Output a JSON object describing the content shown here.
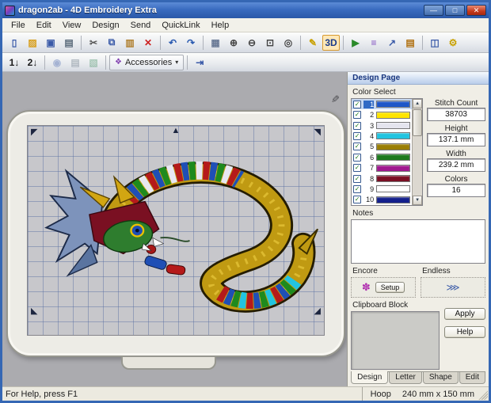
{
  "window": {
    "title": "dragon2ab - 4D Embroidery Extra",
    "controls": [
      {
        "name": "minimize-button",
        "glyph": "—"
      },
      {
        "name": "maximize-button",
        "glyph": "□"
      },
      {
        "name": "close-button",
        "glyph": "✕"
      }
    ]
  },
  "menu": {
    "items": [
      "File",
      "Edit",
      "View",
      "Design",
      "Send",
      "QuickLink",
      "Help"
    ]
  },
  "toolbar1": {
    "icons": [
      {
        "name": "new-document-icon",
        "glyph": "▯",
        "color": "#3a5aa8"
      },
      {
        "name": "open-folder-icon",
        "glyph": "▨",
        "color": "#d8a020"
      },
      {
        "name": "save-icon",
        "glyph": "▣",
        "color": "#3a5aa8"
      },
      {
        "name": "print-icon",
        "glyph": "▤",
        "color": "#5a6a7a"
      },
      {
        "name": "separator"
      },
      {
        "name": "cut-icon",
        "glyph": "✂",
        "color": "#555555"
      },
      {
        "name": "copy-icon",
        "glyph": "⧉",
        "color": "#3a5aa8"
      },
      {
        "name": "paste-icon",
        "glyph": "▥",
        "color": "#b08030"
      },
      {
        "name": "delete-icon",
        "glyph": "✕",
        "color": "#cc2020"
      },
      {
        "name": "separator"
      },
      {
        "name": "undo-icon",
        "glyph": "↶",
        "color": "#2a5ab0"
      },
      {
        "name": "redo-icon",
        "glyph": "↷",
        "color": "#2a5ab0"
      },
      {
        "name": "separator"
      },
      {
        "name": "grid-icon",
        "glyph": "▦",
        "color": "#6a7a96"
      },
      {
        "name": "zoom-in-icon",
        "glyph": "⊕",
        "color": "#444444"
      },
      {
        "name": "zoom-out-icon",
        "glyph": "⊖",
        "color": "#444444"
      },
      {
        "name": "zoom-area-icon",
        "glyph": "⊡",
        "color": "#444444"
      },
      {
        "name": "overview-icon",
        "glyph": "◎",
        "color": "#444444"
      },
      {
        "name": "separator"
      },
      {
        "name": "measure-icon",
        "glyph": "✎",
        "color": "#c8a000"
      },
      {
        "name": "3d-view-button",
        "glyph": "3D",
        "color": "#1a3a8a",
        "pressed": true
      },
      {
        "name": "separator"
      },
      {
        "name": "design-player-icon",
        "glyph": "▶",
        "color": "#2a8a2a"
      },
      {
        "name": "color-sort-icon",
        "glyph": "≡",
        "color": "#8050c0"
      },
      {
        "name": "export-icon",
        "glyph": "↗",
        "color": "#3a5aa8"
      },
      {
        "name": "design-notes-icon",
        "glyph": "▤",
        "color": "#b07010"
      },
      {
        "name": "separator"
      },
      {
        "name": "design-properties-icon",
        "glyph": "◫",
        "color": "#3a5aa8"
      },
      {
        "name": "configure-icon",
        "glyph": "⚙",
        "color": "#c8a000"
      }
    ]
  },
  "toolbar2": {
    "icons_left": [
      {
        "name": "color-change-1-icon",
        "glyph": "1↓",
        "color": "#1a1a1a"
      },
      {
        "name": "color-change-2-icon",
        "glyph": "2↓",
        "color": "#1a1a1a"
      },
      {
        "name": "separator"
      },
      {
        "name": "life-view-icon",
        "glyph": "◉",
        "color": "#3a5aa8",
        "disabled": true
      },
      {
        "name": "print-preview-icon",
        "glyph": "▤",
        "color": "#5a6a7a",
        "disabled": true
      },
      {
        "name": "background-icon",
        "glyph": "▧",
        "color": "#3a8a5a",
        "disabled": true
      },
      {
        "name": "separator"
      }
    ],
    "accessories": {
      "label": "Accessories"
    },
    "icons_right": [
      {
        "name": "separator"
      },
      {
        "name": "send-to-machine-icon",
        "glyph": "⇥",
        "color": "#3a5aa8"
      }
    ]
  },
  "design_page": {
    "title": "Design Page",
    "color_select_label": "Color Select",
    "colors": [
      {
        "num": "1",
        "hex": "#1e56c8"
      },
      {
        "num": "2",
        "hex": "#ffe400"
      },
      {
        "num": "3",
        "hex": "#e4e4ee"
      },
      {
        "num": "4",
        "hex": "#22c4e0"
      },
      {
        "num": "5",
        "hex": "#9a7f06"
      },
      {
        "num": "6",
        "hex": "#1e7a1e"
      },
      {
        "num": "7",
        "hex": "#a01890"
      },
      {
        "num": "8",
        "hex": "#7a0f24"
      },
      {
        "num": "9",
        "hex": "#ffffff"
      },
      {
        "num": "10",
        "hex": "#14208c"
      }
    ],
    "stats": [
      {
        "label": "Stitch Count",
        "value": "38703"
      },
      {
        "label": "Height",
        "value": "137.1 mm"
      },
      {
        "label": "Width",
        "value": "239.2 mm"
      },
      {
        "label": "Colors",
        "value": "16"
      }
    ],
    "notes_label": "Notes",
    "encore": {
      "label": "Encore",
      "setup_label": "Setup",
      "icon": "✽"
    },
    "endless": {
      "label": "Endless",
      "icon": "⋙"
    },
    "clipboard_label": "Clipboard Block",
    "apply_label": "Apply",
    "help_label": "Help",
    "tabs": [
      {
        "label": "Design"
      },
      {
        "label": "Letter"
      },
      {
        "label": "Shape"
      },
      {
        "label": "Edit"
      }
    ]
  },
  "status": {
    "help_text": "For Help, press F1",
    "hoop_label": "Hoop",
    "hoop_value": "240 mm x 150 mm"
  },
  "ui_icons": {
    "check": "✓",
    "scroll_up": "▲",
    "scroll_down": "▼",
    "dropdown": "▾",
    "accessories_mini": "❖",
    "canvas_tool": "✎",
    "corner_tl": "◤",
    "corner_tr": "◥",
    "corner_bl": "◣",
    "corner_br": "◢",
    "top_handle": "▲"
  },
  "accent_colors": {
    "titlebar": "#3a6cc0",
    "selection": "#316ac5",
    "panel_header": "#b9cdea"
  }
}
